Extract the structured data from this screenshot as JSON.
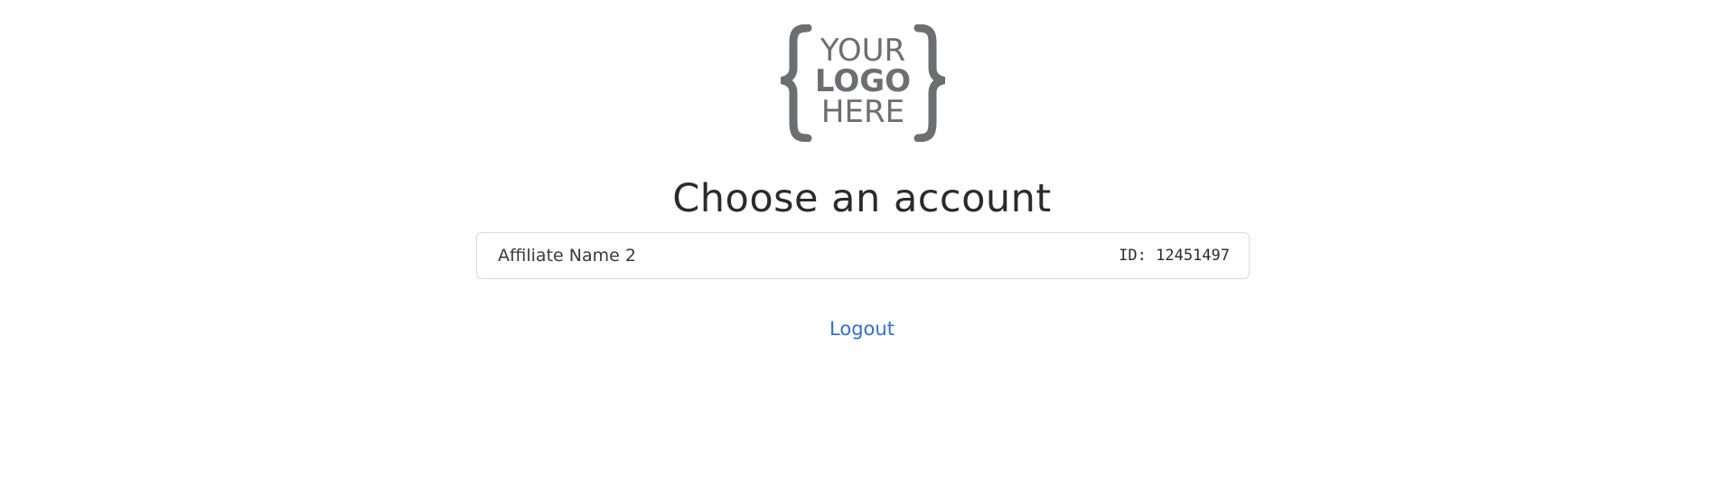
{
  "logo": {
    "line1": "YOUR",
    "line2": "LOGO",
    "line3": "HERE"
  },
  "page": {
    "title": "Choose an account"
  },
  "accounts": [
    {
      "name": "Affiliate Name 2",
      "id_label": "ID: 12451497"
    }
  ],
  "actions": {
    "logout_label": "Logout"
  },
  "colors": {
    "logo_gray": "#6d6e71",
    "link_blue": "#2f6fdb",
    "text_dark": "#2b2b2b",
    "border": "#d9d9d9"
  }
}
